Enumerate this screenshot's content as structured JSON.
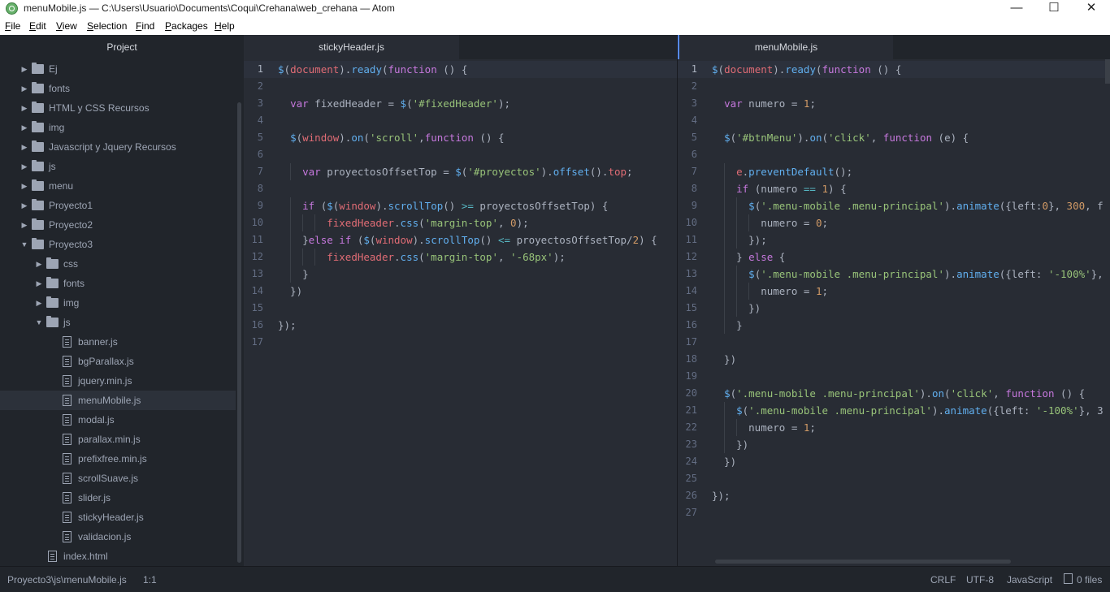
{
  "window": {
    "title": "menuMobile.js — C:\\Users\\Usuario\\Documents\\Coqui\\Crehana\\web_crehana — Atom",
    "minimize": "—",
    "maximize": "☐",
    "close": "✕"
  },
  "menu": [
    "File",
    "Edit",
    "View",
    "Selection",
    "Find",
    "Packages",
    "Help"
  ],
  "sidebar": {
    "title": "Project",
    "tree": [
      {
        "label": "Ej",
        "type": "folder",
        "expanded": false,
        "depth": 0
      },
      {
        "label": "fonts",
        "type": "folder",
        "expanded": false,
        "depth": 0
      },
      {
        "label": "HTML y CSS Recursos",
        "type": "folder",
        "expanded": false,
        "depth": 0
      },
      {
        "label": "img",
        "type": "folder",
        "expanded": false,
        "depth": 0
      },
      {
        "label": "Javascript y Jquery Recursos",
        "type": "folder",
        "expanded": false,
        "depth": 0
      },
      {
        "label": "js",
        "type": "folder",
        "expanded": false,
        "depth": 0
      },
      {
        "label": "menu",
        "type": "folder",
        "expanded": false,
        "depth": 0
      },
      {
        "label": "Proyecto1",
        "type": "folder",
        "expanded": false,
        "depth": 0
      },
      {
        "label": "Proyecto2",
        "type": "folder",
        "expanded": false,
        "depth": 0
      },
      {
        "label": "Proyecto3",
        "type": "folder",
        "expanded": true,
        "depth": 0
      },
      {
        "label": "css",
        "type": "folder",
        "expanded": false,
        "depth": 1
      },
      {
        "label": "fonts",
        "type": "folder",
        "expanded": false,
        "depth": 1
      },
      {
        "label": "img",
        "type": "folder",
        "expanded": false,
        "depth": 1
      },
      {
        "label": "js",
        "type": "folder",
        "expanded": true,
        "depth": 1
      },
      {
        "label": "banner.js",
        "type": "file",
        "depth": 2
      },
      {
        "label": "bgParallax.js",
        "type": "file",
        "depth": 2
      },
      {
        "label": "jquery.min.js",
        "type": "file",
        "depth": 2
      },
      {
        "label": "menuMobile.js",
        "type": "file",
        "depth": 2,
        "selected": true
      },
      {
        "label": "modal.js",
        "type": "file",
        "depth": 2
      },
      {
        "label": "parallax.min.js",
        "type": "file",
        "depth": 2
      },
      {
        "label": "prefixfree.min.js",
        "type": "file",
        "depth": 2
      },
      {
        "label": "scrollSuave.js",
        "type": "file",
        "depth": 2
      },
      {
        "label": "slider.js",
        "type": "file",
        "depth": 2
      },
      {
        "label": "stickyHeader.js",
        "type": "file",
        "depth": 2
      },
      {
        "label": "validacion.js",
        "type": "file",
        "depth": 2
      },
      {
        "label": "index.html",
        "type": "file",
        "depth": 1
      }
    ]
  },
  "left_pane": {
    "tab": "stickyHeader.js",
    "current_line": 1,
    "lines": [
      [
        [
          "f",
          "$"
        ],
        [
          "p",
          "("
        ],
        [
          "v",
          "document"
        ],
        [
          "p",
          ")."
        ],
        [
          "f",
          "ready"
        ],
        [
          "p",
          "("
        ],
        [
          "k",
          "function"
        ],
        [
          "p",
          " () {"
        ]
      ],
      [],
      [
        [
          "p",
          "  "
        ],
        [
          "k",
          "var"
        ],
        [
          "p",
          " fixedHeader = "
        ],
        [
          "f",
          "$"
        ],
        [
          "p",
          "("
        ],
        [
          "s",
          "'#fixedHeader'"
        ],
        [
          "p",
          ");"
        ]
      ],
      [],
      [
        [
          "p",
          "  "
        ],
        [
          "f",
          "$"
        ],
        [
          "p",
          "("
        ],
        [
          "v",
          "window"
        ],
        [
          "p",
          ")."
        ],
        [
          "f",
          "on"
        ],
        [
          "p",
          "("
        ],
        [
          "s",
          "'scroll'"
        ],
        [
          "p",
          ","
        ],
        [
          "k",
          "function"
        ],
        [
          "p",
          " () {"
        ]
      ],
      [],
      [
        [
          "p",
          "    "
        ],
        [
          "k",
          "var"
        ],
        [
          "p",
          " proyectosOffsetTop = "
        ],
        [
          "f",
          "$"
        ],
        [
          "p",
          "("
        ],
        [
          "s",
          "'#proyectos'"
        ],
        [
          "p",
          ")."
        ],
        [
          "f",
          "offset"
        ],
        [
          "p",
          "()."
        ],
        [
          "v",
          "top"
        ],
        [
          "p",
          ";"
        ]
      ],
      [],
      [
        [
          "p",
          "    "
        ],
        [
          "k",
          "if"
        ],
        [
          "p",
          " ("
        ],
        [
          "f",
          "$"
        ],
        [
          "p",
          "("
        ],
        [
          "v",
          "window"
        ],
        [
          "p",
          ")."
        ],
        [
          "f",
          "scrollTop"
        ],
        [
          "p",
          "() "
        ],
        [
          "o",
          ">="
        ],
        [
          "p",
          " proyectosOffsetTop) {"
        ]
      ],
      [
        [
          "p",
          "        "
        ],
        [
          "v",
          "fixedHeader"
        ],
        [
          "p",
          "."
        ],
        [
          "f",
          "css"
        ],
        [
          "p",
          "("
        ],
        [
          "s",
          "'margin-top'"
        ],
        [
          "p",
          ", "
        ],
        [
          "n",
          "0"
        ],
        [
          "p",
          ");"
        ]
      ],
      [
        [
          "p",
          "    }"
        ],
        [
          "k",
          "else if"
        ],
        [
          "p",
          " ("
        ],
        [
          "f",
          "$"
        ],
        [
          "p",
          "("
        ],
        [
          "v",
          "window"
        ],
        [
          "p",
          ")."
        ],
        [
          "f",
          "scrollTop"
        ],
        [
          "p",
          "() "
        ],
        [
          "o",
          "<="
        ],
        [
          "p",
          " proyectosOffsetTop/"
        ],
        [
          "n",
          "2"
        ],
        [
          "p",
          ") {"
        ]
      ],
      [
        [
          "p",
          "        "
        ],
        [
          "v",
          "fixedHeader"
        ],
        [
          "p",
          "."
        ],
        [
          "f",
          "css"
        ],
        [
          "p",
          "("
        ],
        [
          "s",
          "'margin-top'"
        ],
        [
          "p",
          ", "
        ],
        [
          "s",
          "'-68px'"
        ],
        [
          "p",
          ");"
        ]
      ],
      [
        [
          "p",
          "    }"
        ]
      ],
      [
        [
          "p",
          "  })"
        ]
      ],
      [],
      [
        [
          "p",
          "});"
        ]
      ],
      []
    ]
  },
  "right_pane": {
    "tab": "menuMobile.js",
    "current_line": 1,
    "lines": [
      [
        [
          "f",
          "$"
        ],
        [
          "p",
          "("
        ],
        [
          "v",
          "document"
        ],
        [
          "p",
          ")."
        ],
        [
          "f",
          "ready"
        ],
        [
          "p",
          "("
        ],
        [
          "k",
          "function"
        ],
        [
          "p",
          " () {"
        ]
      ],
      [],
      [
        [
          "p",
          "  "
        ],
        [
          "k",
          "var"
        ],
        [
          "p",
          " numero = "
        ],
        [
          "n",
          "1"
        ],
        [
          "p",
          ";"
        ]
      ],
      [],
      [
        [
          "p",
          "  "
        ],
        [
          "f",
          "$"
        ],
        [
          "p",
          "("
        ],
        [
          "s",
          "'#btnMenu'"
        ],
        [
          "p",
          ")."
        ],
        [
          "f",
          "on"
        ],
        [
          "p",
          "("
        ],
        [
          "s",
          "'click'"
        ],
        [
          "p",
          ", "
        ],
        [
          "k",
          "function"
        ],
        [
          "p",
          " (e) {"
        ]
      ],
      [],
      [
        [
          "p",
          "    "
        ],
        [
          "v",
          "e"
        ],
        [
          "p",
          "."
        ],
        [
          "f",
          "preventDefault"
        ],
        [
          "p",
          "();"
        ]
      ],
      [
        [
          "p",
          "    "
        ],
        [
          "k",
          "if"
        ],
        [
          "p",
          " (numero "
        ],
        [
          "o",
          "=="
        ],
        [
          "p",
          " "
        ],
        [
          "n",
          "1"
        ],
        [
          "p",
          ") {"
        ]
      ],
      [
        [
          "p",
          "      "
        ],
        [
          "f",
          "$"
        ],
        [
          "p",
          "("
        ],
        [
          "s",
          "'.menu-mobile .menu-principal'"
        ],
        [
          "p",
          ")."
        ],
        [
          "f",
          "animate"
        ],
        [
          "p",
          "({left:"
        ],
        [
          "n",
          "0"
        ],
        [
          "p",
          "}, "
        ],
        [
          "n",
          "300"
        ],
        [
          "p",
          ", f"
        ]
      ],
      [
        [
          "p",
          "        numero = "
        ],
        [
          "n",
          "0"
        ],
        [
          "p",
          ";"
        ]
      ],
      [
        [
          "p",
          "      });"
        ]
      ],
      [
        [
          "p",
          "    } "
        ],
        [
          "k",
          "else"
        ],
        [
          "p",
          " {"
        ]
      ],
      [
        [
          "p",
          "      "
        ],
        [
          "f",
          "$"
        ],
        [
          "p",
          "("
        ],
        [
          "s",
          "'.menu-mobile .menu-principal'"
        ],
        [
          "p",
          ")."
        ],
        [
          "f",
          "animate"
        ],
        [
          "p",
          "({left: "
        ],
        [
          "s",
          "'-100%'"
        ],
        [
          "p",
          "},"
        ]
      ],
      [
        [
          "p",
          "        numero = "
        ],
        [
          "n",
          "1"
        ],
        [
          "p",
          ";"
        ]
      ],
      [
        [
          "p",
          "      })"
        ]
      ],
      [
        [
          "p",
          "    }"
        ]
      ],
      [],
      [
        [
          "p",
          "  })"
        ]
      ],
      [],
      [
        [
          "p",
          "  "
        ],
        [
          "f",
          "$"
        ],
        [
          "p",
          "("
        ],
        [
          "s",
          "'.menu-mobile .menu-principal'"
        ],
        [
          "p",
          ")."
        ],
        [
          "f",
          "on"
        ],
        [
          "p",
          "("
        ],
        [
          "s",
          "'click'"
        ],
        [
          "p",
          ", "
        ],
        [
          "k",
          "function"
        ],
        [
          "p",
          " () {"
        ]
      ],
      [
        [
          "p",
          "    "
        ],
        [
          "f",
          "$"
        ],
        [
          "p",
          "("
        ],
        [
          "s",
          "'.menu-mobile .menu-principal'"
        ],
        [
          "p",
          ")."
        ],
        [
          "f",
          "animate"
        ],
        [
          "p",
          "({left: "
        ],
        [
          "s",
          "'-100%'"
        ],
        [
          "p",
          "}, 3"
        ]
      ],
      [
        [
          "p",
          "      numero = "
        ],
        [
          "n",
          "1"
        ],
        [
          "p",
          ";"
        ]
      ],
      [
        [
          "p",
          "    })"
        ]
      ],
      [
        [
          "p",
          "  })"
        ]
      ],
      [],
      [
        [
          "p",
          "});"
        ]
      ],
      []
    ]
  },
  "status": {
    "path": "Proyecto3\\js\\menuMobile.js",
    "cursor": "1:1",
    "line_ending": "CRLF",
    "encoding": "UTF-8",
    "grammar": "JavaScript",
    "files": "0 files"
  },
  "colors": {
    "editor_bg": "#282c34",
    "panel_bg": "#21252b",
    "keyword": "#c678dd",
    "function": "#61afef",
    "string": "#98c379",
    "number": "#d19a66",
    "variable": "#e06c75",
    "operator": "#56b6c2",
    "accent": "#568af2"
  }
}
